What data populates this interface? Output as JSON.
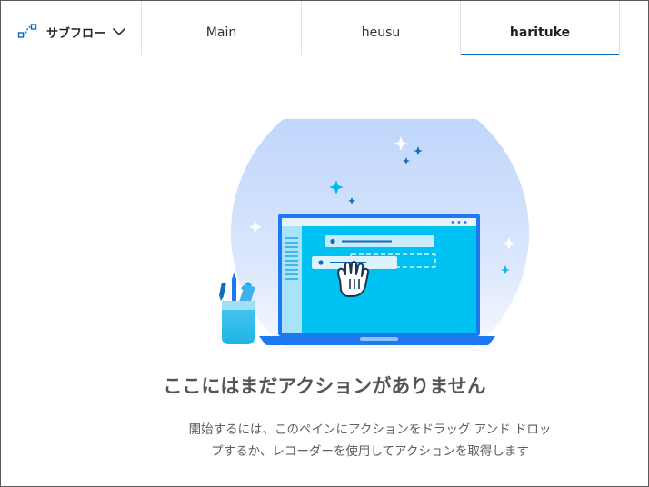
{
  "subflow": {
    "label": "サブフロー",
    "icon": "subflow-icon",
    "dropdown_icon": "chevron-down-icon"
  },
  "tabs": [
    {
      "label": "Main",
      "active": false
    },
    {
      "label": "heusu",
      "active": false
    },
    {
      "label": "harituke",
      "active": true
    }
  ],
  "empty_state": {
    "title": "ここにはまだアクションがありません",
    "description_line1": "開始するには、このペインにアクションをドラッグ アンド ドロッ",
    "description_line2": "プするか、レコーダーを使用してアクションを取得します"
  },
  "colors": {
    "accent": "#0f6cbd",
    "illustration_blue": "#1e78f0",
    "screen_cyan": "#00c2f2",
    "title_text": "#555555",
    "desc_text": "#605e5c"
  }
}
